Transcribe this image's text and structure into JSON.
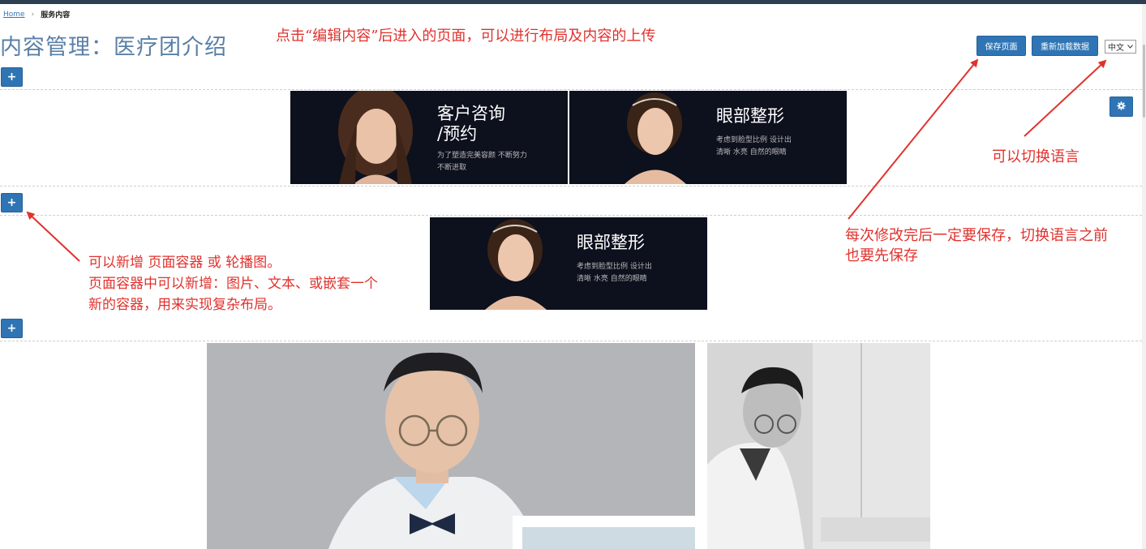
{
  "breadcrumb": {
    "home": "Home",
    "separator": "›",
    "current": "服务内容"
  },
  "page_title": "内容管理：医疗团介绍",
  "toolbar": {
    "save_label": "保存页面",
    "reload_label": "重新加载数据",
    "language_value": "中文",
    "settings_icon": "gear-icon"
  },
  "add_button_symbol": "+",
  "notes": {
    "top": "点击“编辑内容”后进入的页面，可以进行布局及内容的上传",
    "language": "可以切换语言",
    "save_line1": "每次修改完后一定要保存，切换语言之前",
    "save_line2": "也要先保存",
    "add_line1": "可以新增  页面容器  或  轮播图。",
    "add_line2": "页面容器中可以新增：图片、文本、或嵌套一个",
    "add_line3": "新的容器，用来实现复杂布局。"
  },
  "banners": {
    "consult": {
      "title_line1": "客户咨询",
      "title_line2": "/预约",
      "sub_line1": "为了塑造完美容颜  不断努力",
      "sub_line2": "不断进取"
    },
    "eye1": {
      "title": "眼部整形",
      "sub_line1": "考虑到脸型比例  设计出",
      "sub_line2": "清晰  水亮  自然的眼睛"
    },
    "eye2": {
      "title": "眼部整形",
      "sub_line1": "考虑到脸型比例  设计出",
      "sub_line2": "清晰  水亮  自然的眼睛"
    }
  },
  "colors": {
    "annotation": "#e0322d",
    "button": "#2f75b5",
    "banner_bg": "#0d101d",
    "title": "#5a7fa6"
  }
}
